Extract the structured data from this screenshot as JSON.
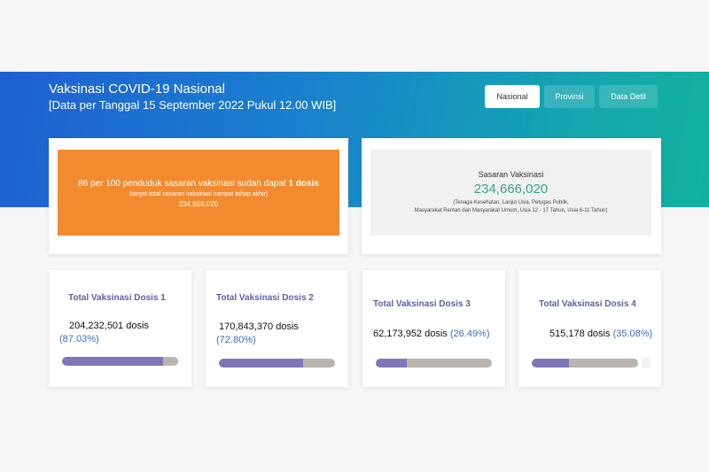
{
  "header": {
    "title": "Vaksinasi COVID-19 Nasional",
    "subtitle": "[Data per Tanggal 15 September 2022 Pukul 12.00 WIB]"
  },
  "nav": [
    {
      "label": "Nasional",
      "active": true
    },
    {
      "label": "Provinsi",
      "active": false
    },
    {
      "label": "Data Detil",
      "active": false
    }
  ],
  "highlight": {
    "text_prefix": "86 per 100 penduduk sasaran vaksinasi sudah dapat ",
    "text_bold": "1 dosis",
    "note": "(target total sasaran vaksinasi sampai tahap akhir)",
    "value": "234,666,020",
    "color": "#f28b30"
  },
  "target": {
    "label": "Sasaran Vaksinasi",
    "value": "234,666,020",
    "desc_line1": "(Tenaga Kesehatan, Lanjut Usia, Petugas Publik,",
    "desc_line2": "Masyarakat Rentan dan Masyarakat Umum, Usia 12 - 17 Tahun, Usia 6-11 Tahun)",
    "value_color": "#3aa38f"
  },
  "doses": [
    {
      "title": "Total Vaksinasi Dosis 1",
      "count": "204,232,501 dosis",
      "pct": "(87.03%)",
      "progress": 0.8703
    },
    {
      "title": "Total Vaksinasi Dosis 2",
      "count": "170,843,370 dosis",
      "pct": "(72.80%)",
      "progress": 0.728
    },
    {
      "title": "Total Vaksinasi Dosis 3",
      "count": "62,173,952 dosis",
      "pct": "(26.49%)",
      "progress": 0.2649
    },
    {
      "title": "Total Vaksinasi Dosis 4",
      "count": "515,178 dosis",
      "pct": "(35.08%)",
      "progress": 0.3508
    }
  ]
}
